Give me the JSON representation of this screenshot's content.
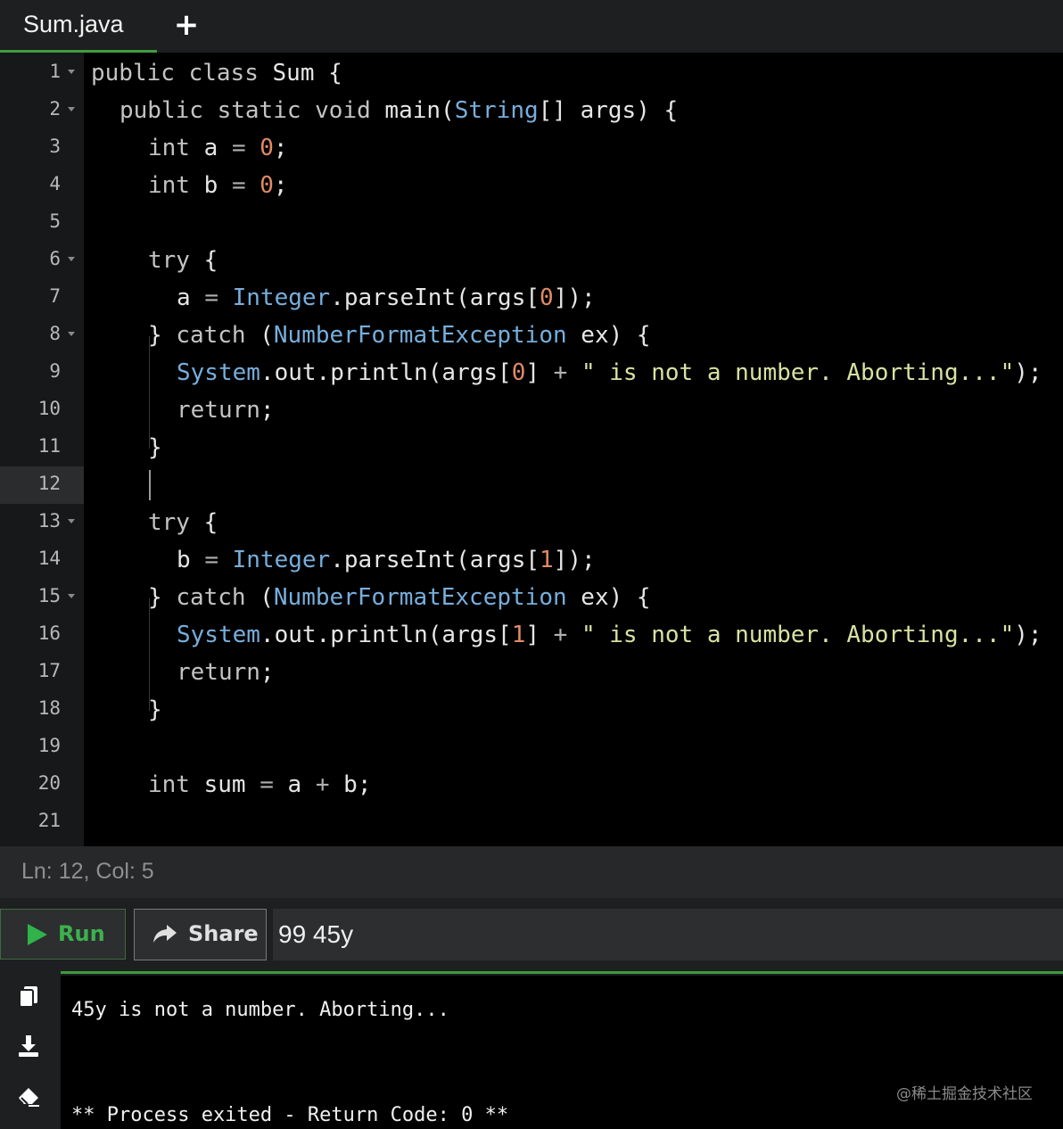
{
  "tabs": {
    "active_label": "Sum.java",
    "add_label": "+"
  },
  "editor": {
    "line_numbers": [
      "1",
      "2",
      "3",
      "4",
      "5",
      "6",
      "7",
      "8",
      "9",
      "10",
      "11",
      "12",
      "13",
      "14",
      "15",
      "16",
      "17",
      "18",
      "19",
      "20",
      "21"
    ],
    "foldable_lines": [
      1,
      2,
      6,
      8,
      13,
      15
    ],
    "active_line": 12,
    "code": {
      "l1_kw1": "public",
      "l1_kw2": "class",
      "l1_rest": " Sum {",
      "l2_kw1": "public",
      "l2_kw2": "static",
      "l2_kw3": "void",
      "l2_a": " main(",
      "l2_type": "String",
      "l2_b": "[] args) {",
      "l3_kw": "int",
      "l3_a": " a ",
      "l3_op": "=",
      "l3_num": "0",
      "l3_end": ";",
      "l4_kw": "int",
      "l4_a": " b ",
      "l4_op": "=",
      "l4_num": "0",
      "l4_end": ";",
      "l6_kw": "try",
      "l6_rest": " {",
      "l7_a": "a ",
      "l7_op": "=",
      "l7_type": "Integer",
      "l7_b": ".parseInt(args[",
      "l7_num": "0",
      "l7_end": "]);",
      "l8_a": "} ",
      "l8_kw": "catch",
      "l8_b": " (",
      "l8_type": "NumberFormatException",
      "l8_c": " ex) {",
      "l9_type": "System",
      "l9_a": ".out.println(args[",
      "l9_num": "0",
      "l9_b": "] ",
      "l9_op": "+",
      "l9_str": "\" is not a number. Aborting...\"",
      "l9_end": ");",
      "l10_kw": "return",
      "l10_end": ";",
      "l11_rest": "}",
      "l13_kw": "try",
      "l13_rest": " {",
      "l14_a": "b ",
      "l14_op": "=",
      "l14_type": "Integer",
      "l14_b": ".parseInt(args[",
      "l14_num": "1",
      "l14_end": "]);",
      "l15_a": "} ",
      "l15_kw": "catch",
      "l15_b": " (",
      "l15_type": "NumberFormatException",
      "l15_c": " ex) {",
      "l16_type": "System",
      "l16_a": ".out.println(args[",
      "l16_num": "1",
      "l16_b": "] ",
      "l16_op": "+",
      "l16_str": "\" is not a number. Aborting...\"",
      "l16_end": ");",
      "l17_kw": "return",
      "l17_end": ";",
      "l18_rest": "}",
      "l20_kw": "int",
      "l20_a": " sum ",
      "l20_op1": "=",
      "l20_b": " a ",
      "l20_op2": "+",
      "l20_c": " b;"
    }
  },
  "status": {
    "cursor_position": "Ln: 12,  Col: 5"
  },
  "toolbar": {
    "run_label": "Run",
    "share_label": "Share",
    "args_value": "99 45y"
  },
  "side_tools": [
    "copy-icon",
    "download-icon",
    "erase-icon"
  ],
  "console": {
    "line1": "45y is not a number. Aborting...",
    "line2": "** Process exited - Return Code: 0 **"
  },
  "watermark": "@稀土掘金技术社区",
  "colors": {
    "accent_green": "#3cb14d",
    "keyword": "#c3c3c3",
    "type": "#77aedc",
    "number": "#e08a66",
    "string": "#d7e2a2"
  }
}
